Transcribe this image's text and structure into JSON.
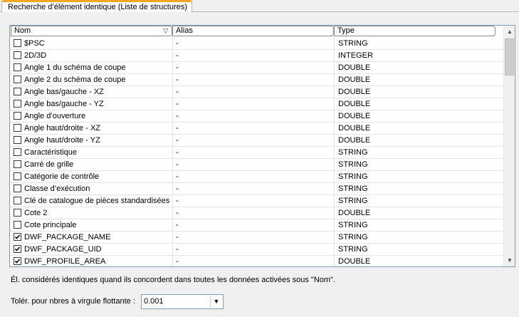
{
  "tab": {
    "label": "Recherche d’élément identique (Liste de structures)"
  },
  "columns": {
    "name": "Nom",
    "alias": "Alias",
    "type": "Type"
  },
  "rows": [
    {
      "name": "$PSC",
      "alias": "-",
      "type": "STRING",
      "checked": false
    },
    {
      "name": "2D/3D",
      "alias": "-",
      "type": "INTEGER",
      "checked": false
    },
    {
      "name": "Angle 1 du schéma de coupe",
      "alias": "-",
      "type": "DOUBLE",
      "checked": false
    },
    {
      "name": "Angle 2 du schéma de coupe",
      "alias": "-",
      "type": "DOUBLE",
      "checked": false
    },
    {
      "name": "Angle bas/gauche - XZ",
      "alias": "-",
      "type": "DOUBLE",
      "checked": false
    },
    {
      "name": "Angle bas/gauche - YZ",
      "alias": "-",
      "type": "DOUBLE",
      "checked": false
    },
    {
      "name": "Angle d’ouverture",
      "alias": "-",
      "type": "DOUBLE",
      "checked": false
    },
    {
      "name": "Angle haut/droite - XZ",
      "alias": "-",
      "type": "DOUBLE",
      "checked": false
    },
    {
      "name": "Angle haut/droite - YZ",
      "alias": "-",
      "type": "DOUBLE",
      "checked": false
    },
    {
      "name": "Caractéristique",
      "alias": "-",
      "type": "STRING",
      "checked": false
    },
    {
      "name": "Carré de grille",
      "alias": "-",
      "type": "STRING",
      "checked": false
    },
    {
      "name": "Catégorie de contrôle",
      "alias": "-",
      "type": "STRING",
      "checked": false
    },
    {
      "name": "Classe d’exécution",
      "alias": "-",
      "type": "STRING",
      "checked": false
    },
    {
      "name": "Clé de catalogue de pièces standardisées",
      "alias": "-",
      "type": "STRING",
      "checked": false
    },
    {
      "name": "Cote 2",
      "alias": "-",
      "type": "DOUBLE",
      "checked": false
    },
    {
      "name": "Cote principale",
      "alias": "-",
      "type": "STRING",
      "checked": false
    },
    {
      "name": "DWF_PACKAGE_NAME",
      "alias": "-",
      "type": "STRING",
      "checked": true
    },
    {
      "name": "DWF_PACKAGE_UID",
      "alias": "-",
      "type": "STRING",
      "checked": true
    },
    {
      "name": "DWF_PROFILE_AREA",
      "alias": "-",
      "type": "DOUBLE",
      "checked": true
    }
  ],
  "note": "Él. considérés identiques quand ils concordent dans toutes les données activées sous \"Nom\".",
  "tolerance": {
    "label": "Tolér. pour nbres à virgule flottante :",
    "value": "0.001"
  },
  "icons": {
    "sort": "sort-down-icon",
    "scroll_up": "arrow-up-icon",
    "scroll_down": "arrow-down-icon",
    "dropdown": "chevron-down-icon",
    "check": "check-icon"
  }
}
